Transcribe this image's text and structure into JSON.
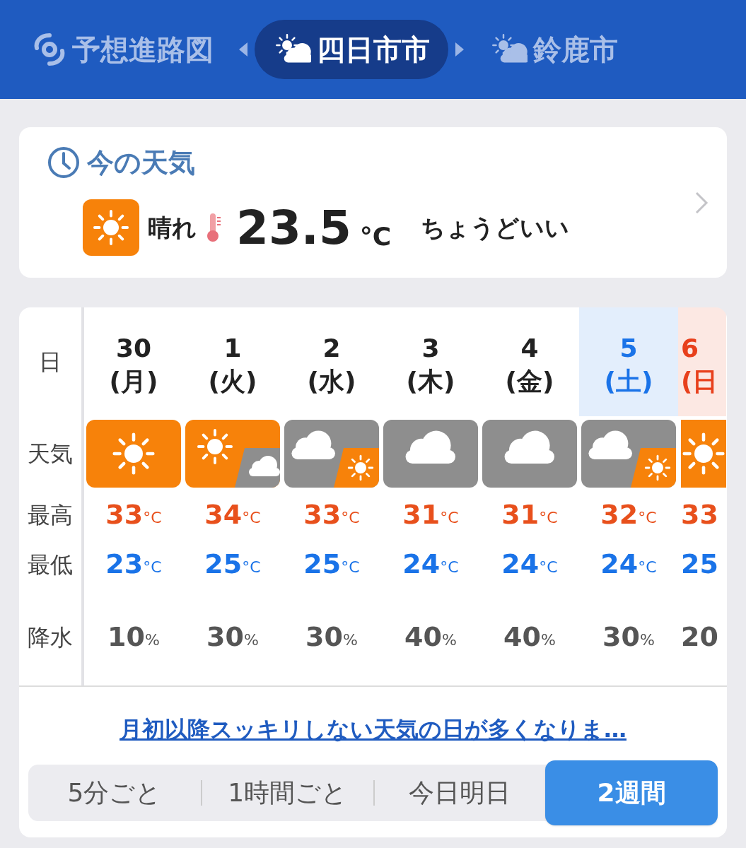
{
  "header": {
    "tabs": [
      {
        "label": "予想進路図",
        "kind": "typhoon",
        "selected": false
      },
      {
        "label": "四日市市",
        "kind": "weather",
        "selected": true
      },
      {
        "label": "鈴鹿市",
        "kind": "weather",
        "selected": false
      }
    ]
  },
  "current": {
    "title": "今の天気",
    "condition": "晴れ",
    "temperature": "23.5",
    "unit": "°C",
    "feeling": "ちょうどいい"
  },
  "forecast": {
    "row_labels": [
      "日",
      "天気",
      "最高",
      "最低",
      "降水"
    ],
    "days": [
      {
        "date": "30",
        "weekday": "(月)",
        "color": "#222222",
        "highlighted": false,
        "kind": "sunny",
        "high": "33",
        "high_unit": "°C",
        "low": "23",
        "low_unit": "°C",
        "precip": "10",
        "precip_unit": "%"
      },
      {
        "date": "1",
        "weekday": "(火)",
        "color": "#222222",
        "highlighted": false,
        "kind": "sunny_then_cloudy",
        "high": "34",
        "high_unit": "°C",
        "low": "25",
        "low_unit": "°C",
        "precip": "30",
        "precip_unit": "%"
      },
      {
        "date": "2",
        "weekday": "(水)",
        "color": "#222222",
        "highlighted": false,
        "kind": "cloudy_then_sunny",
        "high": "33",
        "high_unit": "°C",
        "low": "25",
        "low_unit": "°C",
        "precip": "30",
        "precip_unit": "%"
      },
      {
        "date": "3",
        "weekday": "(木)",
        "color": "#222222",
        "highlighted": false,
        "kind": "cloudy",
        "high": "31",
        "high_unit": "°C",
        "low": "24",
        "low_unit": "°C",
        "precip": "40",
        "precip_unit": "%"
      },
      {
        "date": "4",
        "weekday": "(金)",
        "color": "#222222",
        "highlighted": false,
        "kind": "cloudy",
        "high": "31",
        "high_unit": "°C",
        "low": "24",
        "low_unit": "°C",
        "precip": "40",
        "precip_unit": "%"
      },
      {
        "date": "5",
        "weekday": "(土)",
        "color": "#1a73e8",
        "highlighted": true,
        "kind": "cloudy_then_sunny",
        "high": "32",
        "high_unit": "°C",
        "low": "24",
        "low_unit": "°C",
        "precip": "30",
        "precip_unit": "%"
      },
      {
        "date": "6",
        "weekday": "(日",
        "color": "#e8401c",
        "highlighted": true,
        "kind": "sunny",
        "high": "33",
        "low": "25",
        "precip": "20"
      }
    ]
  },
  "link": "月初以降スッキリしない天気の日が多くなりま…",
  "period_tabs": [
    {
      "label": "5分ごと",
      "selected": false
    },
    {
      "label": "1時間ごと",
      "selected": false
    },
    {
      "label": "今日明日",
      "selected": false
    },
    {
      "label": "2週間",
      "selected": true
    }
  ]
}
